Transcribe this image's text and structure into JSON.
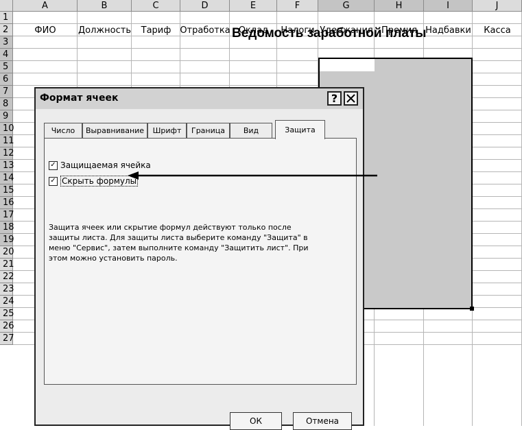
{
  "spreadsheet": {
    "columns": [
      "A",
      "B",
      "C",
      "D",
      "E",
      "F",
      "G",
      "H",
      "I",
      "J"
    ],
    "rows": [
      "1",
      "2",
      "3",
      "4",
      "5",
      "6",
      "7",
      "8",
      "9",
      "10",
      "11",
      "12",
      "13",
      "14",
      "15",
      "16",
      "17",
      "18",
      "19",
      "20",
      "21",
      "22",
      "23",
      "24",
      "25",
      "26",
      "27"
    ],
    "title": "Ведомость заработной платы",
    "headers": [
      "ФИО",
      "Должность",
      "Тариф",
      "Отработка",
      "Оклад",
      "Налоги",
      "Удержания",
      "Премия",
      "Надбавки",
      "Касса"
    ]
  },
  "dialog": {
    "title": "Формат ячеек",
    "help_icon": "question-icon",
    "close_icon": "close-icon",
    "tabs": [
      "Число",
      "Выравнивание",
      "Шрифт",
      "Граница",
      "Вид",
      "Защита"
    ],
    "active_tab": "Защита",
    "checkbox_protected": {
      "label": "Защищаемая ячейка",
      "checked": true
    },
    "checkbox_hide_formulas": {
      "label": "Скрыть формулы",
      "checked": true
    },
    "info_line1": "Защита ячеек или скрытие формул действуют только после",
    "info_line2": "защиты листа. Для защиты листа выберите команду \"Защита\" в",
    "info_line3": "меню \"Сервис\", затем выполните команду \"Защитить лист\". При",
    "info_line4": "этом можно установить пароль.",
    "ok_label": "ОК",
    "cancel_label": "Отмена",
    "check_mark": "✓"
  }
}
